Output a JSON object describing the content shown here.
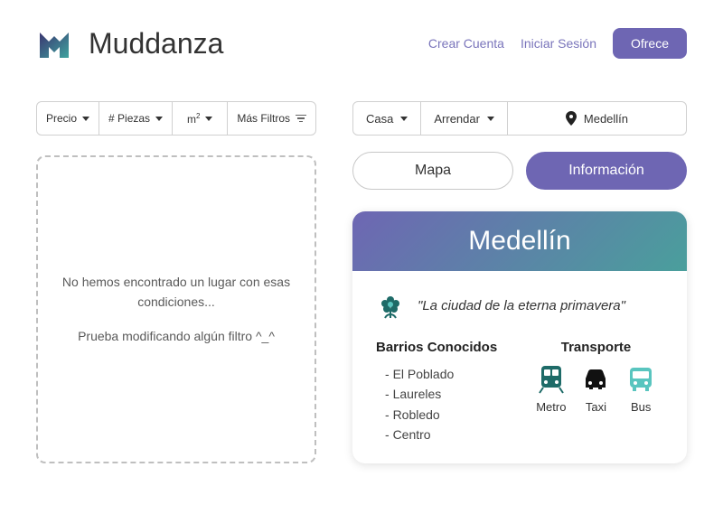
{
  "brand": {
    "name": "Muddanza"
  },
  "nav": {
    "create": "Crear Cuenta",
    "login": "Iniciar Sesión",
    "offer": "Ofrece"
  },
  "filters": {
    "price": "Precio",
    "rooms": "# Piezas",
    "area_base": "m",
    "area_exp": "2",
    "more": "Más Filtros"
  },
  "empty": {
    "line1": "No hemos encontrado un lugar con esas condiciones...",
    "line2": "Prueba modificando algún filtro ^_^"
  },
  "search": {
    "type": "Casa",
    "mode": "Arrendar",
    "city": "Medellín"
  },
  "tabs": {
    "map": "Mapa",
    "info": "Información"
  },
  "card": {
    "title": "Medellín",
    "slogan": "\"La ciudad de la eterna primavera\"",
    "barrios_title": "Barrios Conocidos",
    "barrios": [
      "El Poblado",
      "Laureles",
      "Robledo",
      "Centro"
    ],
    "transport_title": "Transporte",
    "transport": {
      "metro": "Metro",
      "taxi": "Taxi",
      "bus": "Bus"
    }
  },
  "colors": {
    "primary": "#6e66b3",
    "teal": "#4a9f9c",
    "dark_teal": "#1e6b68"
  }
}
